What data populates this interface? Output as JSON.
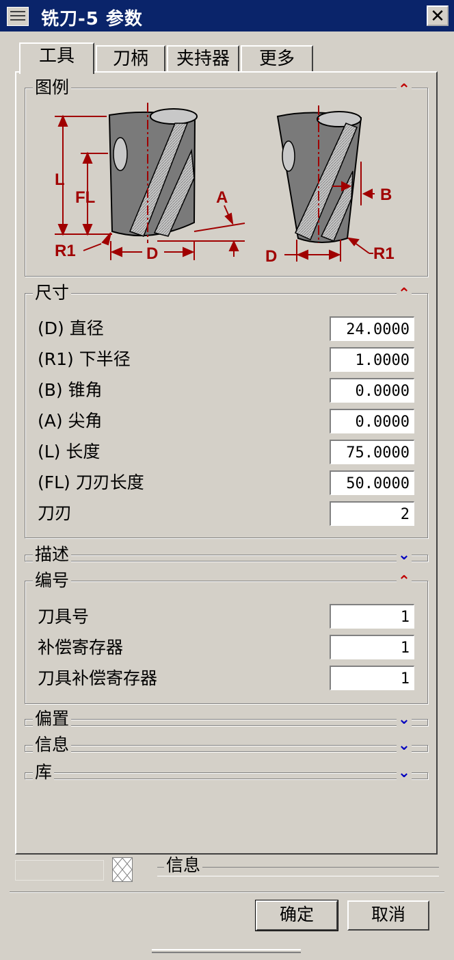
{
  "window": {
    "title": "铣刀-5 参数",
    "close_glyph": "✕"
  },
  "tabs": [
    {
      "label": "工具",
      "active": true
    },
    {
      "label": "刀柄",
      "active": false
    },
    {
      "label": "夹持器",
      "active": false
    },
    {
      "label": "更多",
      "active": false
    }
  ],
  "legend": {
    "label": "图例",
    "labels": {
      "L": "L",
      "FL": "FL",
      "R1_left": "R1",
      "D_left": "D",
      "A": "A",
      "B": "B",
      "D_right": "D",
      "R1_right": "R1"
    }
  },
  "dimensions": {
    "label": "尺寸",
    "rows": [
      {
        "label": "(D) 直径",
        "value": "24.0000"
      },
      {
        "label": "(R1) 下半径",
        "value": "1.0000"
      },
      {
        "label": "(B) 锥角",
        "value": "0.0000"
      },
      {
        "label": "(A) 尖角",
        "value": "0.0000"
      },
      {
        "label": "(L) 长度",
        "value": "75.0000"
      },
      {
        "label": "(FL) 刀刃长度",
        "value": "50.0000"
      },
      {
        "label": "刀刃",
        "value": "2"
      }
    ]
  },
  "description": {
    "label": "描述"
  },
  "numbering": {
    "label": "编号",
    "rows": [
      {
        "label": "刀具号",
        "value": "1"
      },
      {
        "label": "补偿寄存器",
        "value": "1"
      },
      {
        "label": "刀具补偿寄存器",
        "value": "1"
      }
    ]
  },
  "offset": {
    "label": "偏置"
  },
  "info": {
    "label": "信息"
  },
  "library": {
    "label": "库"
  },
  "status": {
    "label": "信息"
  },
  "buttons": {
    "ok": "确定",
    "cancel": "取消"
  },
  "icons": {
    "expand_up": "chevron-up-double-icon",
    "expand_down": "chevron-down-double-icon"
  },
  "colors": {
    "titlebar": "#0a246a",
    "dimension_red": "#a00000",
    "chevron_up": "#c00000",
    "chevron_down": "#0000c0"
  }
}
